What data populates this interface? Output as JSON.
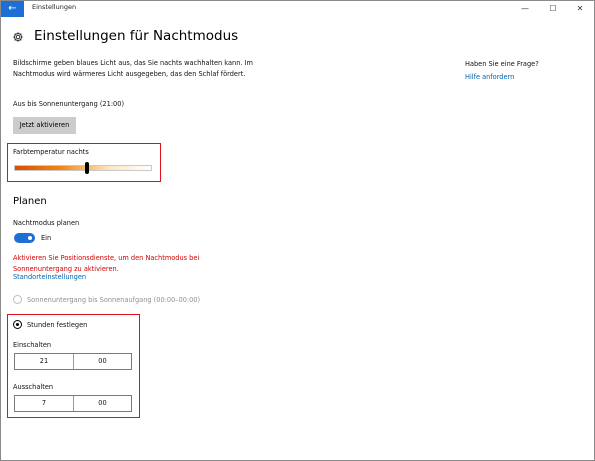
{
  "titlebar": {
    "back_glyph": "←",
    "app_title": "Einstellungen",
    "minimize": "—",
    "maximize": "☐",
    "close": "✕"
  },
  "page": {
    "title": "Einstellungen für Nachtmodus",
    "description": "Bildschirme geben blaues Licht aus, das Sie nachts wachhalten kann. Im Nachtmodus wird wärmeres Licht ausgegeben, das den Schlaf fördert.",
    "status": "Aus bis Sonnenuntergang (21:00)",
    "activate_button": "Jetzt aktivieren"
  },
  "color_temperature": {
    "label": "Farbtemperatur nachts",
    "value_fraction": 0.53
  },
  "schedule": {
    "section_title": "Planen",
    "plan_label": "Nachtmodus planen",
    "toggle_state": "Ein",
    "warning": "Aktivieren Sie Positionsdienste, um den Nachtmodus bei Sonnenuntergang zu aktivieren.",
    "location_link": "Standorteinstellungen",
    "option_sunset": "Sonnenuntergang bis Sonnenaufgang (00:00–00:00)",
    "option_hours": "Stunden festlegen",
    "on_label": "Einschalten",
    "on_hour": "21",
    "on_minute": "00",
    "off_label": "Ausschalten",
    "off_hour": "7",
    "off_minute": "00"
  },
  "side": {
    "question": "Haben Sie eine Frage?",
    "help_link": "Hilfe anfordern"
  },
  "colors": {
    "accent": "#1d6fd6",
    "highlight_border": "#e0101c",
    "warning_text": "#d10000",
    "link": "#0063b1"
  }
}
